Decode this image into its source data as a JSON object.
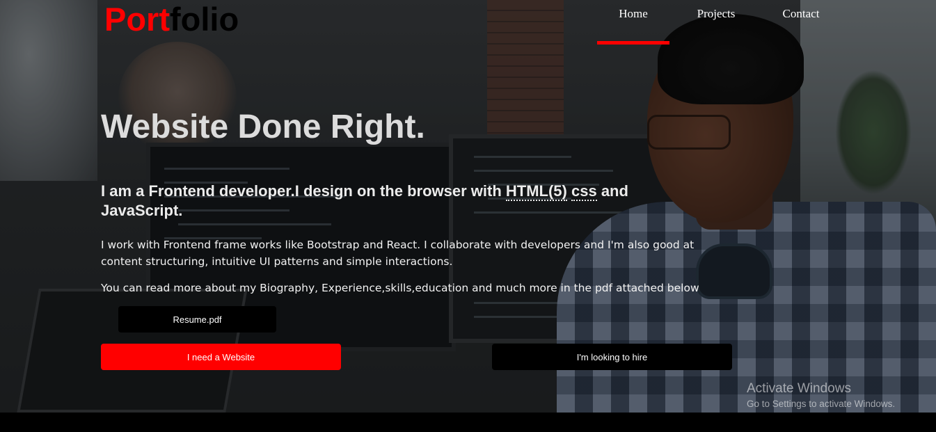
{
  "header": {
    "logo_part1": "Port",
    "logo_part2": "folio",
    "nav": [
      {
        "label": "Home",
        "active": true
      },
      {
        "label": "Projects",
        "active": false
      },
      {
        "label": "Contact",
        "active": false
      }
    ]
  },
  "hero": {
    "headline": "Website Done Right.",
    "intro_before": "I am a Frontend developer.I design on the browser with ",
    "intro_abbr1": "HTML(5)",
    "intro_space": " ",
    "intro_abbr2": "css",
    "intro_after": " and JavaScript.",
    "paragraph1": "I work with Frontend frame works like Bootstrap and React. I collaborate with developers and I'm also good at content structuring, intuitive UI patterns and simple interactions.",
    "paragraph2": "You can read more about my Biography, Experience,skills,education and much more in the pdf attached below"
  },
  "buttons": {
    "resume": "Resume.pdf",
    "need_website": "I need a Website",
    "hire": "I'm looking to hire"
  },
  "watermark": {
    "title": "Activate Windows",
    "subtitle": "Go to Settings to activate Windows."
  },
  "colors": {
    "accent": "#ff0000",
    "button_dark": "#000000",
    "text_light": "#ececec"
  }
}
